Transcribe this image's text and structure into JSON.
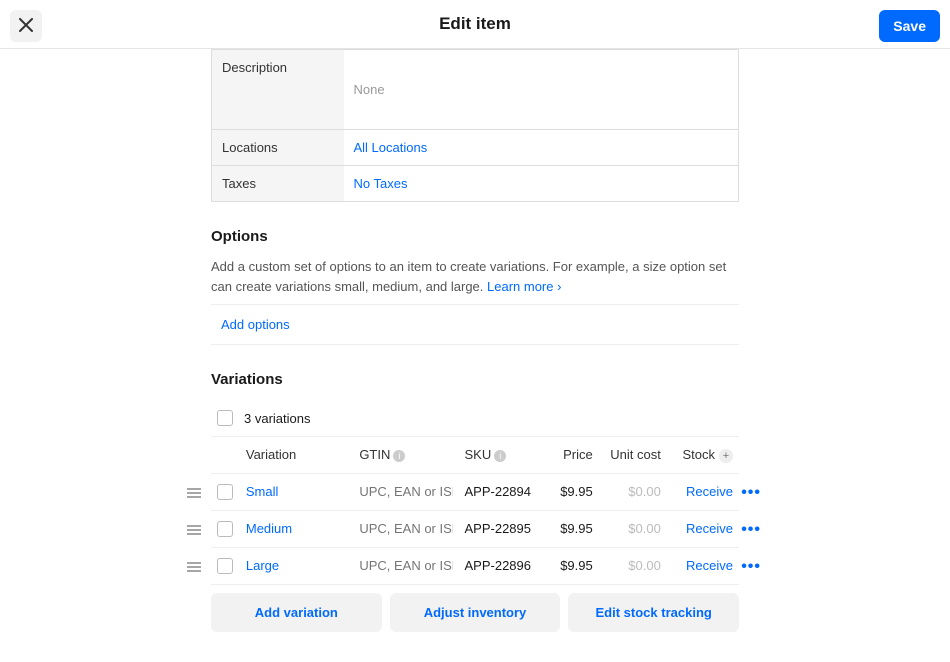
{
  "header": {
    "title": "Edit item",
    "save_label": "Save"
  },
  "details": {
    "description_label": "Description",
    "description_value": "None",
    "locations_label": "Locations",
    "locations_value": "All Locations",
    "taxes_label": "Taxes",
    "taxes_value": "No Taxes"
  },
  "options": {
    "title": "Options",
    "description": "Add a custom set of options to an item to create variations. For example, a size option set can create variations small, medium, and large. ",
    "learn_more": "Learn more ›",
    "add_options": "Add options"
  },
  "variations": {
    "title": "Variations",
    "count_label": "3 variations",
    "headers": {
      "variation": "Variation",
      "gtin": "GTIN",
      "sku": "SKU",
      "price": "Price",
      "unit_cost": "Unit cost",
      "stock": "Stock"
    },
    "gtin_placeholder": "UPC, EAN or ISBN",
    "receive_label": "Receive",
    "rows": [
      {
        "name": "Small",
        "sku": "APP-22894",
        "price": "$9.95",
        "unit_cost": "$0.00"
      },
      {
        "name": "Medium",
        "sku": "APP-22895",
        "price": "$9.95",
        "unit_cost": "$0.00"
      },
      {
        "name": "Large",
        "sku": "APP-22896",
        "price": "$9.95",
        "unit_cost": "$0.00"
      }
    ],
    "actions": {
      "add_variation": "Add variation",
      "adjust_inventory": "Adjust inventory",
      "edit_stock_tracking": "Edit stock tracking"
    }
  }
}
